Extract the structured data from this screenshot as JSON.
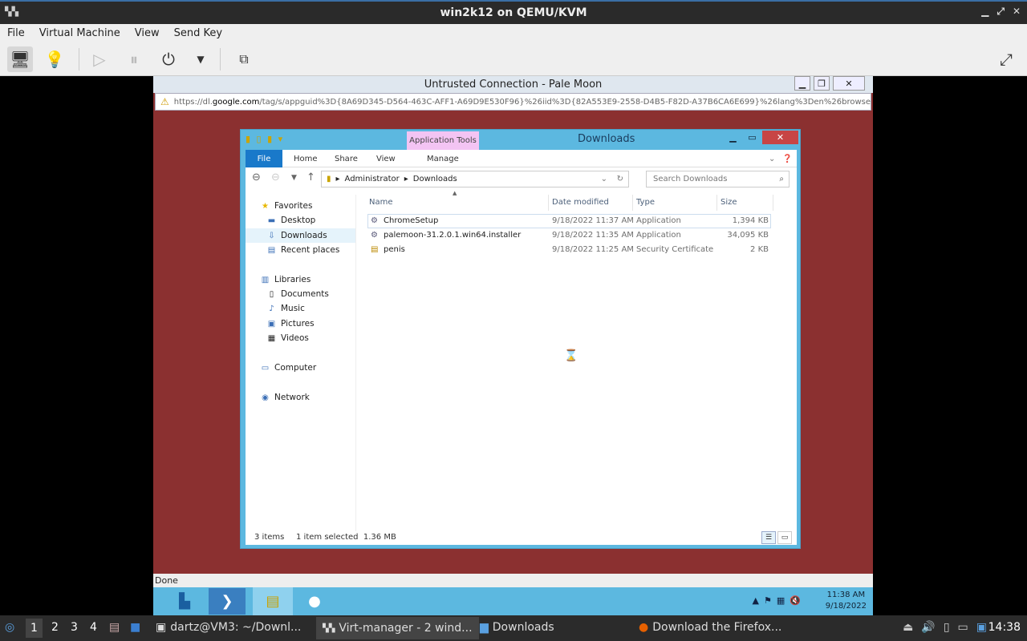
{
  "window": {
    "title": "win2k12 on QEMU/KVM",
    "logo_icon": "virt-manager-icon"
  },
  "menu": [
    "File",
    "Virtual Machine",
    "View",
    "Send Key"
  ],
  "toolbar": {
    "icons": [
      "monitor-icon",
      "lightbulb-icon",
      "play-icon",
      "pause-icon",
      "power-icon",
      "dropdown-icon",
      "screenshot-icon",
      "fullscreen-icon"
    ]
  },
  "palemoon": {
    "title": "Untrusted Connection - Pale Moon",
    "url_prefix": "https://dl.",
    "url_domain": "google.com",
    "url_rest": "/tag/s/appguid%3D{8A69D345-D564-463C-AFF1-A69D9E530F96}%26iid%3D{82A553E9-2558-D4B5-F82D-A37B6CA6E699}%26lang%3Den%26browser%3D3%26usa",
    "status": "Done"
  },
  "explorer": {
    "title": "Downloads",
    "app_tools": "Application Tools",
    "tabs": {
      "file": "File",
      "home": "Home",
      "share": "Share",
      "view": "View",
      "manage": "Manage"
    },
    "breadcrumb": [
      "Administrator",
      "Downloads"
    ],
    "search_placeholder": "Search Downloads",
    "nav": {
      "favorites": "Favorites",
      "desktop": "Desktop",
      "downloads": "Downloads",
      "recent": "Recent places",
      "libraries": "Libraries",
      "documents": "Documents",
      "music": "Music",
      "pictures": "Pictures",
      "videos": "Videos",
      "computer": "Computer",
      "network": "Network"
    },
    "columns": {
      "name": "Name",
      "date": "Date modified",
      "type": "Type",
      "size": "Size"
    },
    "files": [
      {
        "name": "ChromeSetup",
        "date": "9/18/2022 11:37 AM",
        "type": "Application",
        "size": "1,394 KB"
      },
      {
        "name": "palemoon-31.2.0.1.win64.installer",
        "date": "9/18/2022 11:35 AM",
        "type": "Application",
        "size": "34,095 KB"
      },
      {
        "name": "penis",
        "date": "9/18/2022 11:25 AM",
        "type": "Security Certificate",
        "size": "2 KB"
      }
    ],
    "status": {
      "items": "3 items",
      "selected": "1 item selected  1.36 MB"
    }
  },
  "win_taskbar": {
    "time": "11:38 AM",
    "date": "9/18/2022"
  },
  "panel": {
    "workspaces": [
      "1",
      "2",
      "3",
      "4"
    ],
    "tasks": [
      "dartz@VM3: ~/Downl...",
      "Virt-manager - 2 wind...",
      "Downloads",
      "Download the Firefox..."
    ],
    "time": "14:38"
  },
  "colors": {
    "win_accent": "#5cb8e0",
    "vm_bg": "#8b3030",
    "close_red": "#c74545"
  }
}
